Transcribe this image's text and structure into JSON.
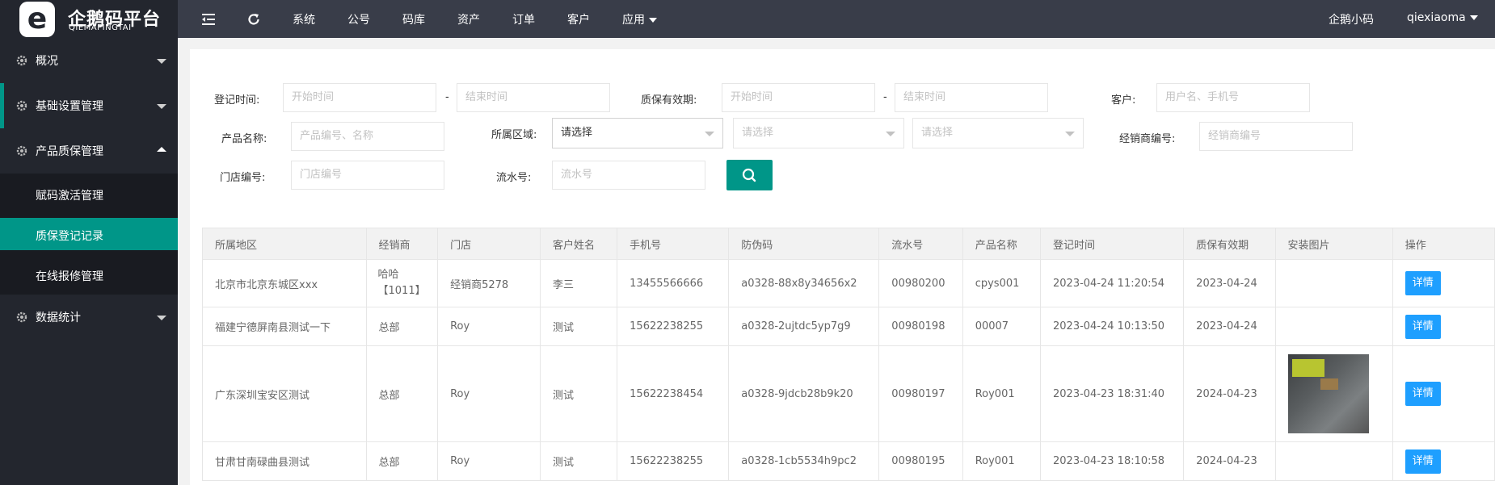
{
  "app": {
    "logo_title": "企鹅码平台",
    "logo_sub": "QIEMAPINGTAI"
  },
  "topnav": {
    "items": [
      "系统",
      "公号",
      "码库",
      "资产",
      "订单",
      "客户",
      "应用"
    ],
    "miniprogram": "企鹅小码",
    "user": "qiexiaoma"
  },
  "sidebar": {
    "items": [
      {
        "label": "概况"
      },
      {
        "label": "基础设置管理"
      },
      {
        "label": "产品质保管理"
      },
      {
        "label": "数据统计"
      }
    ],
    "sub_items": [
      {
        "label": "赋码激活管理"
      },
      {
        "label": "质保登记记录"
      },
      {
        "label": "在线报修管理"
      }
    ]
  },
  "filters": {
    "reg_time_label": "登记时间:",
    "start_placeholder": "开始时间",
    "end_placeholder": "结束时间",
    "dash": "-",
    "warranty_label": "质保有效期:",
    "customer_label": "客户:",
    "customer_placeholder": "用户名、手机号",
    "product_label": "产品名称:",
    "product_placeholder": "产品编号、名称",
    "region_label": "所属区域:",
    "region_selected": "请选择",
    "region_placeholder": "请选择",
    "dealer_label": "经销商编号:",
    "dealer_placeholder": "经销商编号",
    "store_label": "门店编号:",
    "store_placeholder": "门店编号",
    "serial_label": "流水号:",
    "serial_placeholder": "流水号"
  },
  "table": {
    "headers": [
      "所属地区",
      "经销商",
      "门店",
      "客户姓名",
      "手机号",
      "防伪码",
      "流水号",
      "产品名称",
      "登记时间",
      "质保有效期",
      "安装图片",
      "操作"
    ],
    "detail_label": "详情",
    "rows": [
      [
        "北京市北京东城区xxx",
        "哈哈【1011】",
        "经销商5278",
        "李三",
        "13455566666",
        "a0328-88x8y34656x2",
        "00980200",
        "cpys001",
        "2023-04-24 11:20:54",
        "2023-04-24",
        ""
      ],
      [
        "福建宁德屏南县测试一下",
        "总部",
        "Roy",
        "测试",
        "15622238255",
        "a0328-2ujtdc5yp7g9",
        "00980198",
        "00007",
        "2023-04-24 10:13:50",
        "2023-04-24",
        ""
      ],
      [
        "广东深圳宝安区测试",
        "总部",
        "Roy",
        "测试",
        "15622238454",
        "a0328-9jdcb28b9k20",
        "00980197",
        "Roy001",
        "2023-04-23 18:31:40",
        "2024-04-23",
        "photo"
      ],
      [
        "甘肃甘南碌曲县测试",
        "总部",
        "Roy",
        "测试",
        "15622238255",
        "a0328-1cb5534h9pc2",
        "00980195",
        "Roy001",
        "2023-04-23 18:10:58",
        "2024-04-23",
        ""
      ]
    ]
  },
  "colors": {
    "topbar": "#393d49",
    "sidebar": "#23262e",
    "accent": "#009688",
    "detail": "#1e9fff"
  }
}
